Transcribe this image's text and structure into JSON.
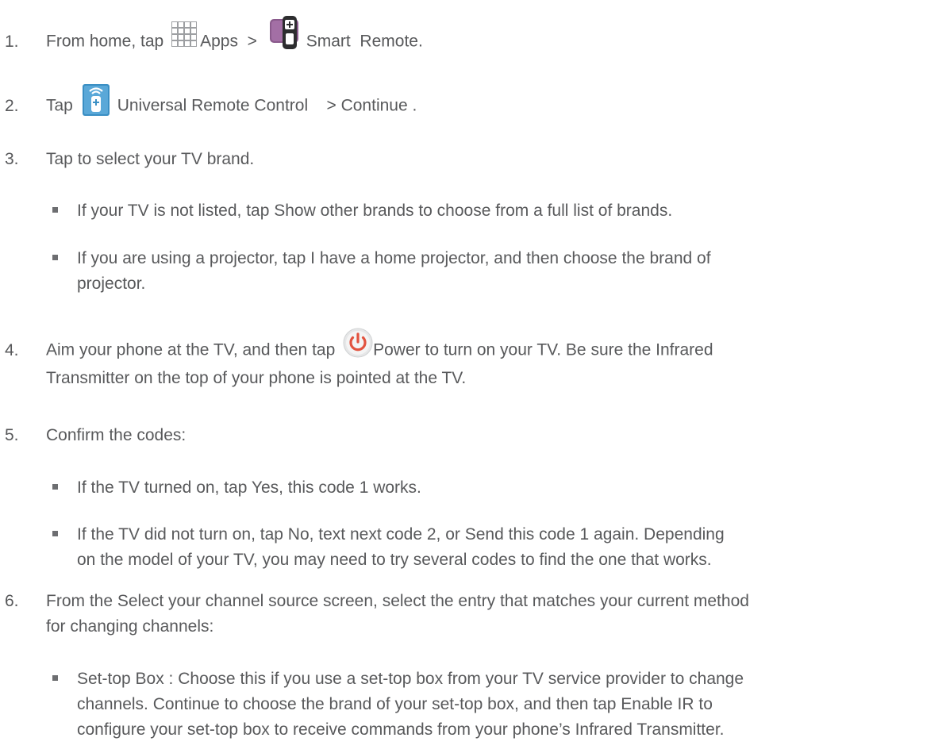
{
  "steps": [
    {
      "num": "1.",
      "parts": [
        "From home, tap",
        "Apps",
        ">",
        "Smart",
        "Remote",
        "."
      ]
    },
    {
      "num": "2.",
      "parts": [
        "Tap",
        "Universal Remote Control",
        "> Continue",
        "."
      ]
    },
    {
      "num": "3.",
      "text": "Tap to select your TV brand."
    },
    {
      "num": "4.",
      "parts": [
        "Aim your phone at the TV, and then tap",
        "Power",
        "to turn on your TV. Be sure the Infrared"
      ],
      "line2": "Transmitter on the top of your phone is pointed at the TV."
    },
    {
      "num": "5.",
      "text": "Confirm the codes:"
    },
    {
      "num": "6.",
      "line1": "From the Select your channel source screen, select the entry that matches your current method",
      "line2": "for changing channels:"
    }
  ],
  "bullets_step3": [
    {
      "line1": "If your TV is not listed, tap Show other brands   to choose from a full list of brands."
    },
    {
      "line1": "If you are using a projector, tap I have a home projector, and then choose the brand of",
      "line2": "projector."
    }
  ],
  "bullets_step5": [
    {
      "line1": "If the TV turned on, tap Yes, this code 1 works."
    },
    {
      "line1": "If the TV did not turn on, tap No, text next code 2, or   Send this code 1 again. Depending",
      "line2": "on the model of your TV, you may need to try several codes to find the one that works."
    }
  ],
  "bullets_step6": [
    {
      "line1": "Set-top Box : Choose this if you use a set-top box from your TV service provider to change",
      "line2": "channels. Continue to choose the brand of your set-top box, and then tap Enable IR  to",
      "line3": "configure your set-top box to receive commands from your phone’s Infrared Transmitter."
    }
  ],
  "icons": {
    "apps": "apps-grid-icon",
    "smart_remote": "smart-remote-icon",
    "universal_remote": "universal-remote-icon",
    "power": "power-icon",
    "power_color": "#e2533f",
    "remote_color": "#8a5a8c",
    "urc_color": "#3a8fc4"
  }
}
